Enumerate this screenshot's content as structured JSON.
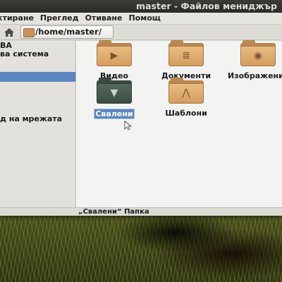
{
  "window": {
    "title": "master - Файлов мениджър"
  },
  "menubar": {
    "items": [
      "ктиране",
      "Преглед",
      "Отиване",
      "Помощ"
    ]
  },
  "location": {
    "path": "/home/master/"
  },
  "sidebar": {
    "items": [
      {
        "label": "ВА"
      },
      {
        "label": "ва система"
      },
      {
        "label": ""
      },
      {
        "label": "д на мрежата"
      }
    ]
  },
  "content": {
    "items": [
      {
        "name": "Видео",
        "icon": "video-camera-icon",
        "selected": false
      },
      {
        "name": "Документи",
        "icon": "document-icon",
        "selected": false
      },
      {
        "name": "Изображения",
        "icon": "camera-icon",
        "selected": false
      },
      {
        "name": "Свалени",
        "icon": "download-arrow-icon",
        "selected": true
      },
      {
        "name": "Шаблони",
        "icon": "compass-icon",
        "selected": false
      }
    ]
  },
  "status": {
    "text": "„Свалени“ Папка"
  },
  "colors": {
    "titlebar": "#3c3b37",
    "selection": "#5b86c0",
    "folder": "#d39d5e"
  }
}
